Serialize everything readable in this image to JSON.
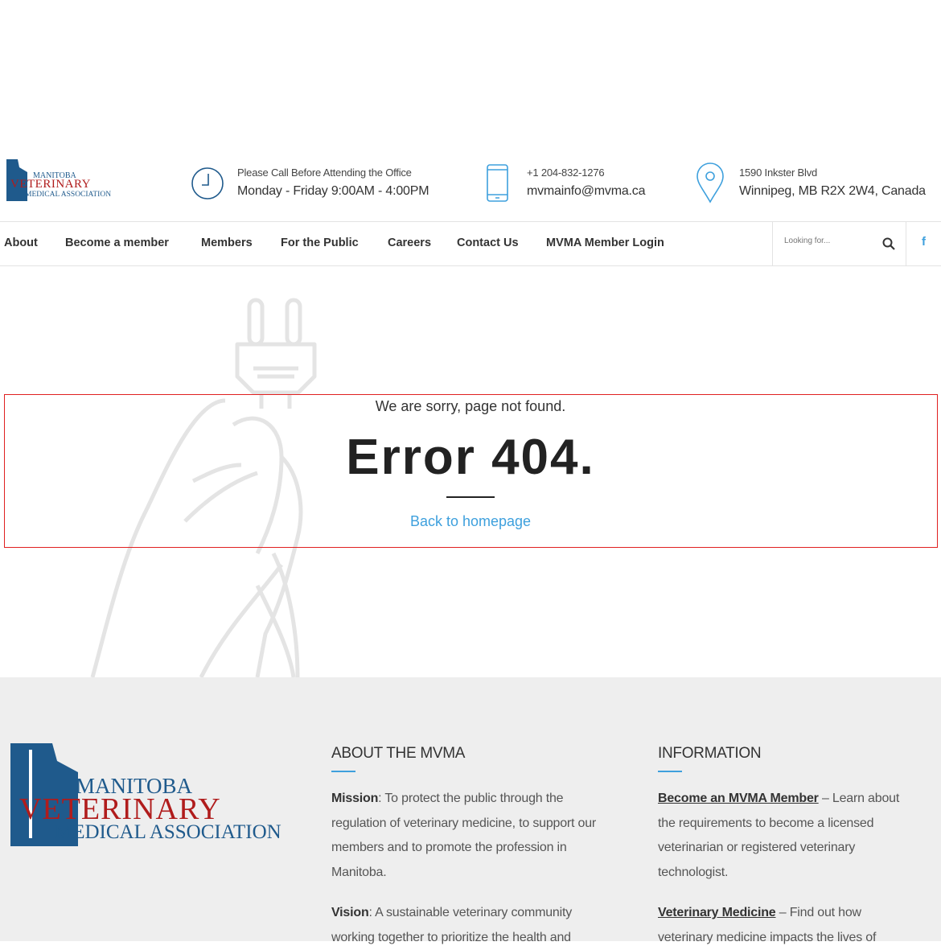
{
  "logo": {
    "line1": "MANITOBA",
    "line2": "VETERINARY",
    "line3": "MEDICAL ASSOCIATION"
  },
  "header": {
    "hours_label": "Please Call Before Attending the Office",
    "hours": "Monday - Friday 9:00AM - 4:00PM",
    "phone": "+1 204-832-1276",
    "email": "mvmainfo@mvma.ca",
    "street": "1590 Inkster Blvd",
    "city": "Winnipeg, MB R2X 2W4, Canada"
  },
  "nav": {
    "items": [
      "About",
      "Become a member",
      "Members",
      "For the Public",
      "Careers",
      "Contact Us",
      "MVMA Member Login"
    ],
    "search_placeholder": "Looking for..."
  },
  "error": {
    "sorry": "We are sorry, page not found.",
    "title": "Error 404.",
    "back": "Back to homepage"
  },
  "footer": {
    "about_title": "ABOUT THE MVMA",
    "mission_label": "Mission",
    "mission": ": To protect the public through the regulation of veterinary medicine, to support our members and to promote the profession in Manitoba.",
    "vision_label": "Vision",
    "vision": ": A sustainable veterinary community working together to prioritize the health and",
    "info_title": "INFORMATION",
    "link1": "Become an MVMA Member",
    "link1_text": " – Learn about the requirements to become a licensed veterinarian or registered veterinary technologist.",
    "link2": "Veterinary Medicine",
    "link2_text": " – Find out how veterinary medicine impacts the lives of"
  },
  "colors": {
    "accent": "#3ea0dd",
    "navy": "#1f5a8c",
    "red": "#b01c1c",
    "footer_bg": "#eeeeee"
  }
}
